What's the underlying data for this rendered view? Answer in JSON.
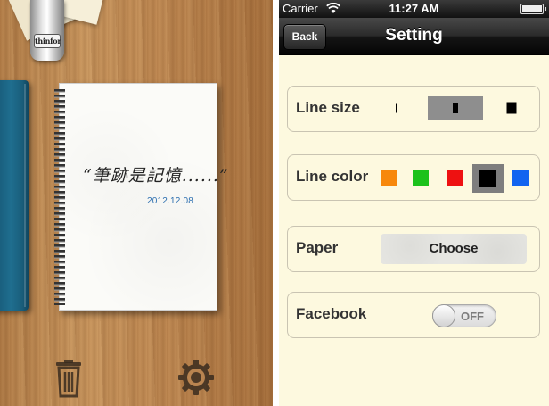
{
  "left_screen": {
    "clip_label": "thinfor",
    "notebook": {
      "title": "“筆跡是記憶......”",
      "date": "2012.12.08"
    },
    "bottom_icons": [
      "trash-icon",
      "gear-icon"
    ]
  },
  "status_bar": {
    "carrier": "Carrier",
    "time": "11:27 AM"
  },
  "nav": {
    "back_label": "Back",
    "title": "Setting"
  },
  "settings": {
    "line_size": {
      "label": "Line size",
      "options": [
        "small",
        "medium",
        "large"
      ],
      "selected": "medium"
    },
    "line_color": {
      "label": "Line color",
      "options": [
        "#f7880c",
        "#1cc21c",
        "#ee1111",
        "#000000",
        "#1264f0"
      ],
      "selected": "#000000"
    },
    "paper": {
      "label": "Paper",
      "button_label": "Choose"
    },
    "facebook": {
      "label": "Facebook",
      "toggle_text": "OFF",
      "state": "off"
    }
  }
}
